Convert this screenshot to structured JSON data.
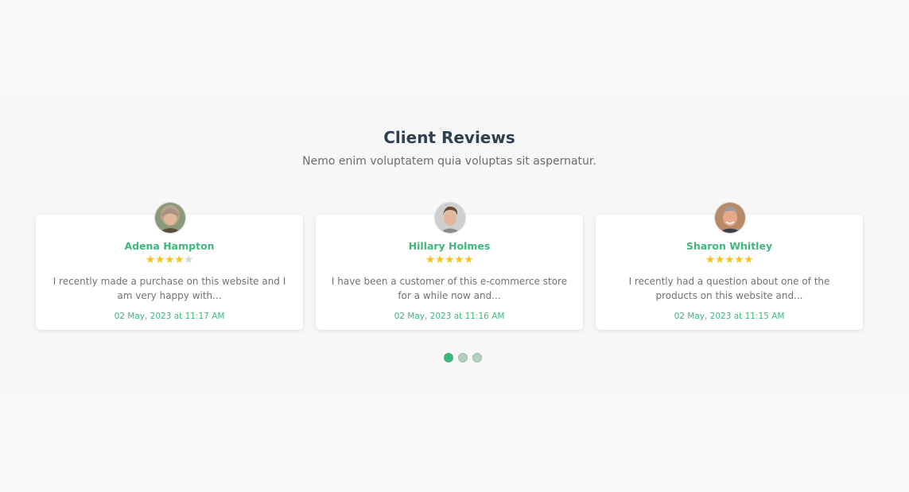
{
  "section": {
    "title": "Client Reviews",
    "subtitle": "Nemo enim voluptatem quia voluptas sit aspernatur."
  },
  "reviews": [
    {
      "name": "Adena Hampton",
      "rating": 4,
      "max_rating": 5,
      "text": "I recently made a purchase on this website and I am very happy with...",
      "date": "02 May, 2023 at 11:17 AM",
      "avatar": "avatar-woman-grey-hair"
    },
    {
      "name": "Hillary Holmes",
      "rating": 5,
      "max_rating": 5,
      "text": "I have been a customer of this e-commerce store for a while now and...",
      "date": "02 May, 2023 at 11:16 AM",
      "avatar": "avatar-young-man-brown-hair"
    },
    {
      "name": "Sharon Whitley",
      "rating": 5,
      "max_rating": 5,
      "text": "I recently had a question about one of the products on this website and...",
      "date": "02 May, 2023 at 11:15 AM",
      "avatar": "avatar-older-man-smiling"
    }
  ],
  "carousel": {
    "pages": 3,
    "active_page": 1
  },
  "colors": {
    "accent": "#3fb67a",
    "star": "#f5c518",
    "star_empty": "#d7d7d7",
    "title": "#2f3f4f",
    "text": "#727272"
  }
}
